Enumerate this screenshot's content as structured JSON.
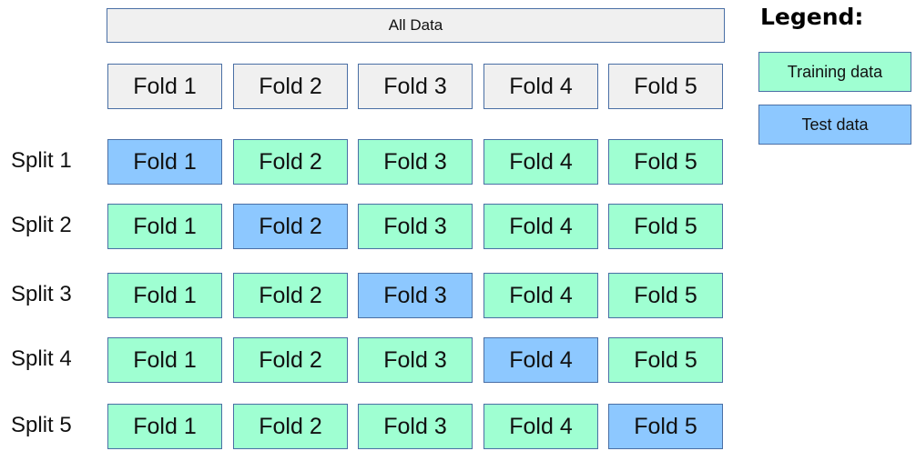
{
  "colors": {
    "neutral": "#f0f0f0",
    "training": "#9fffd2",
    "test": "#8dc8ff",
    "border": "#4a6fa5"
  },
  "all_data_label": "All Data",
  "folds_header": [
    "Fold 1",
    "Fold 2",
    "Fold 3",
    "Fold 4",
    "Fold 5"
  ],
  "splits": [
    {
      "label": "Split 1",
      "folds": [
        "Fold 1",
        "Fold 2",
        "Fold 3",
        "Fold 4",
        "Fold 5"
      ],
      "test_index": 0
    },
    {
      "label": "Split 2",
      "folds": [
        "Fold 1",
        "Fold 2",
        "Fold 3",
        "Fold 4",
        "Fold 5"
      ],
      "test_index": 1
    },
    {
      "label": "Split 3",
      "folds": [
        "Fold 1",
        "Fold 2",
        "Fold 3",
        "Fold 4",
        "Fold 5"
      ],
      "test_index": 2
    },
    {
      "label": "Split 4",
      "folds": [
        "Fold 1",
        "Fold 2",
        "Fold 3",
        "Fold 4",
        "Fold 5"
      ],
      "test_index": 3
    },
    {
      "label": "Split 5",
      "folds": [
        "Fold 1",
        "Fold 2",
        "Fold 3",
        "Fold 4",
        "Fold 5"
      ],
      "test_index": 4
    }
  ],
  "legend": {
    "title": "Legend:",
    "training_label": "Training data",
    "test_label": "Test data"
  }
}
